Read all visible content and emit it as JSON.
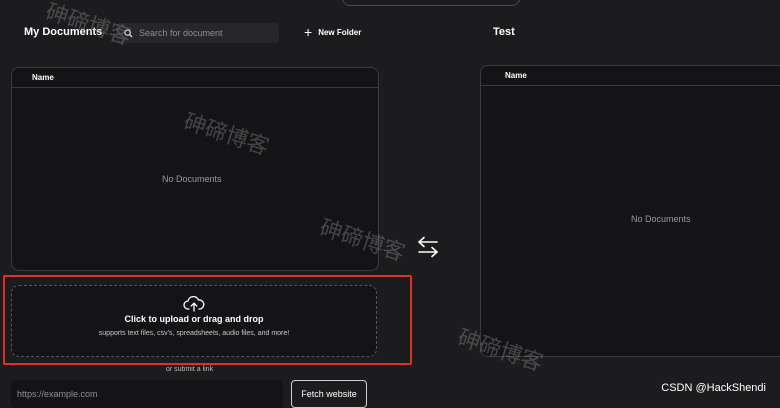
{
  "left": {
    "title": "My Documents",
    "search": {
      "placeholder": "Search for document",
      "value": ""
    },
    "new_folder_label": "New Folder",
    "table": {
      "column_name": "Name",
      "empty_text": "No Documents"
    },
    "upload": {
      "title": "Click to upload or drag and drop",
      "subtitle": "supports text files, csv's, spreadsheets, audio files, and more!"
    },
    "submit_link_text": "or submit a link",
    "url_input": {
      "placeholder": "https://example.com",
      "value": ""
    },
    "fetch_button_label": "Fetch website"
  },
  "right": {
    "title": "Test",
    "table": {
      "column_name": "Name",
      "empty_text": "No Documents"
    }
  },
  "icons": {
    "search": "search-icon",
    "plus": "plus-icon",
    "cloud_upload": "cloud-upload-icon",
    "swap": "swap-arrows-icon"
  },
  "colors": {
    "background": "#1c1c1e",
    "panel": "#141416",
    "highlight_outline": "#e0302a"
  },
  "watermarks": [
    "砷碲博客",
    "砷碲博客",
    "砷碲博客",
    "砷碲博客"
  ],
  "credit": "CSDN @HackShendi"
}
